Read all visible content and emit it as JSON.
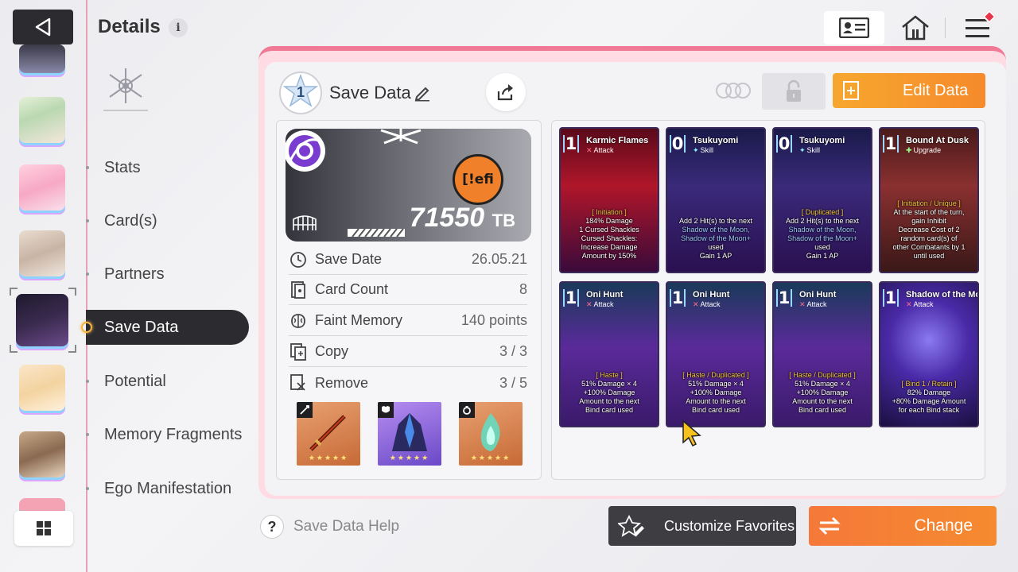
{
  "header": {
    "title": "Details",
    "info_label": "i"
  },
  "nav": {
    "items": [
      {
        "label": "Stats"
      },
      {
        "label": "Card(s)"
      },
      {
        "label": "Partners"
      },
      {
        "label": "Save Data"
      },
      {
        "label": "Potential"
      },
      {
        "label": "Memory Fragments"
      },
      {
        "label": "Ego Manifestation"
      }
    ],
    "active": "Save Data"
  },
  "panel": {
    "save_slot_number": "1",
    "save_label": "Save Data",
    "edit_button": "Edit Data",
    "banner_tb": "71550",
    "banner_tb_unit": "TB",
    "banner_logo_text": "[!efi",
    "stats": [
      {
        "label": "Save Date",
        "value": "26.05.21",
        "icon": "clock-icon"
      },
      {
        "label": "Card Count",
        "value": "8",
        "icon": "card-icon"
      },
      {
        "label": "Faint Memory",
        "value": "140 points",
        "icon": "brain-icon"
      },
      {
        "label": "Copy",
        "value": "3 / 3",
        "icon": "copy-icon"
      },
      {
        "label": "Remove",
        "value": "3 / 5",
        "icon": "remove-icon"
      }
    ],
    "equipment": [
      {
        "type": "weapon",
        "icon": "sword-icon",
        "stars": "★★★★★"
      },
      {
        "type": "armor",
        "icon": "armor-icon",
        "stars": "★★★★★"
      },
      {
        "type": "accessory",
        "icon": "ring-icon",
        "stars": "★★★★★"
      }
    ]
  },
  "cards": [
    {
      "cost": "1",
      "name": "Karmic Flames",
      "type": "Attack",
      "tag": "[ Initiation ]",
      "lines": [
        "184% Damage",
        "1 Cursed Shackles",
        "Cursed Shackles:",
        "Increase Damage",
        "Amount by 150%"
      ]
    },
    {
      "cost": "0",
      "name": "Tsukuyomi",
      "type": "Skill",
      "tag": "",
      "lines": [
        "Add 2 Hit(s) to the next",
        "Shadow of the Moon,",
        "Shadow of the Moon+",
        "used",
        "Gain 1 AP"
      ]
    },
    {
      "cost": "0",
      "name": "Tsukuyomi",
      "type": "Skill",
      "tag": "[ Duplicated ]",
      "lines": [
        "Add 2 Hit(s) to the next",
        "Shadow of the Moon,",
        "Shadow of the Moon+",
        "used",
        "Gain 1 AP"
      ]
    },
    {
      "cost": "1",
      "name": "Bound At Dusk",
      "type": "Upgrade",
      "tag": "[ Initiation / Unique ]",
      "lines": [
        "At the start of the turn,",
        "gain Inhibit",
        "Decrease Cost of 2",
        "random card(s) of",
        "other Combatants by 1",
        "until used"
      ]
    },
    {
      "cost": "1",
      "name": "Oni Hunt",
      "type": "Attack",
      "tag": "[ Haste ]",
      "lines": [
        "51% Damage × 4",
        "+100% Damage",
        "Amount to the next",
        "Bind card used"
      ]
    },
    {
      "cost": "1",
      "name": "Oni Hunt",
      "type": "Attack",
      "tag": "[ Haste / Duplicated ]",
      "lines": [
        "51% Damage × 4",
        "+100% Damage",
        "Amount to the next",
        "Bind card used"
      ]
    },
    {
      "cost": "1",
      "name": "Oni Hunt",
      "type": "Attack",
      "tag": "[ Haste / Duplicated ]",
      "lines": [
        "51% Damage × 4",
        "+100% Damage",
        "Amount to the next",
        "Bind card used"
      ]
    },
    {
      "cost": "1",
      "name": "Shadow of the Moon",
      "type": "Attack",
      "tag": "[ Bind 1 / Retain ]",
      "lines": [
        "82% Damage",
        "+80% Damage Amount",
        "for each Bind stack"
      ]
    }
  ],
  "footer": {
    "help_mark": "?",
    "help_label": "Save Data Help",
    "favorites_button": "Customize Favorites",
    "change_button": "Change"
  },
  "colors": {
    "accent_orange": "#f68a2c",
    "dark_button": "#3d3d42",
    "panel_pink": "#f07a96",
    "active_nav": "#2b2b30"
  }
}
